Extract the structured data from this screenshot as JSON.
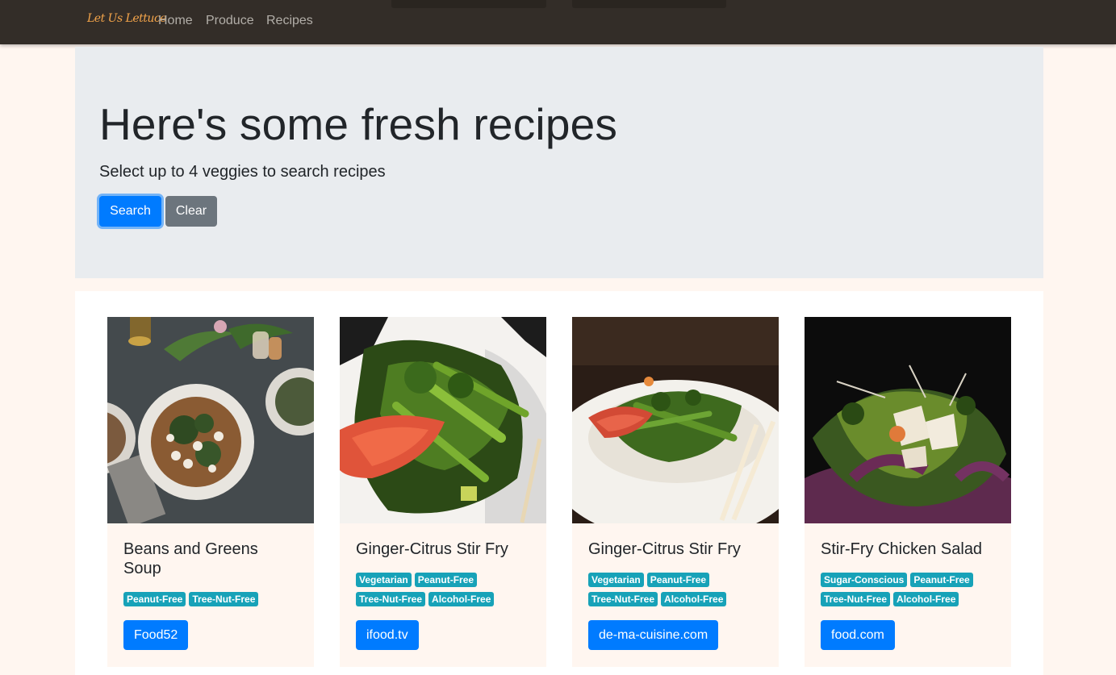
{
  "navbar": {
    "brand": "Let Us Lettuce",
    "links": [
      "Home",
      "Produce",
      "Recipes"
    ]
  },
  "jumbotron": {
    "title": "Here's some fresh recipes",
    "subtitle": "Select up to 4 veggies to search recipes",
    "search_label": "Search",
    "clear_label": "Clear"
  },
  "recipes": [
    {
      "title": "Beans and Greens Soup",
      "badges": [
        "Peanut-Free",
        "Tree-Nut-Free"
      ],
      "source": "Food52"
    },
    {
      "title": "Ginger-Citrus Stir Fry",
      "badges": [
        "Vegetarian",
        "Peanut-Free",
        "Tree-Nut-Free",
        "Alcohol-Free"
      ],
      "source": "ifood.tv"
    },
    {
      "title": "Ginger-Citrus Stir Fry",
      "badges": [
        "Vegetarian",
        "Peanut-Free",
        "Tree-Nut-Free",
        "Alcohol-Free"
      ],
      "source": "de-ma-cuisine.com"
    },
    {
      "title": "Stir-Fry Chicken Salad",
      "badges": [
        "Sugar-Conscious",
        "Peanut-Free",
        "Tree-Nut-Free",
        "Alcohol-Free"
      ],
      "source": "food.com"
    }
  ],
  "colors": {
    "navbar": "#332d28",
    "brand": "#f5a54a",
    "primary": "#007bff",
    "secondary": "#6c757d",
    "badge": "#17a2b8",
    "card": "#fff6f0"
  }
}
